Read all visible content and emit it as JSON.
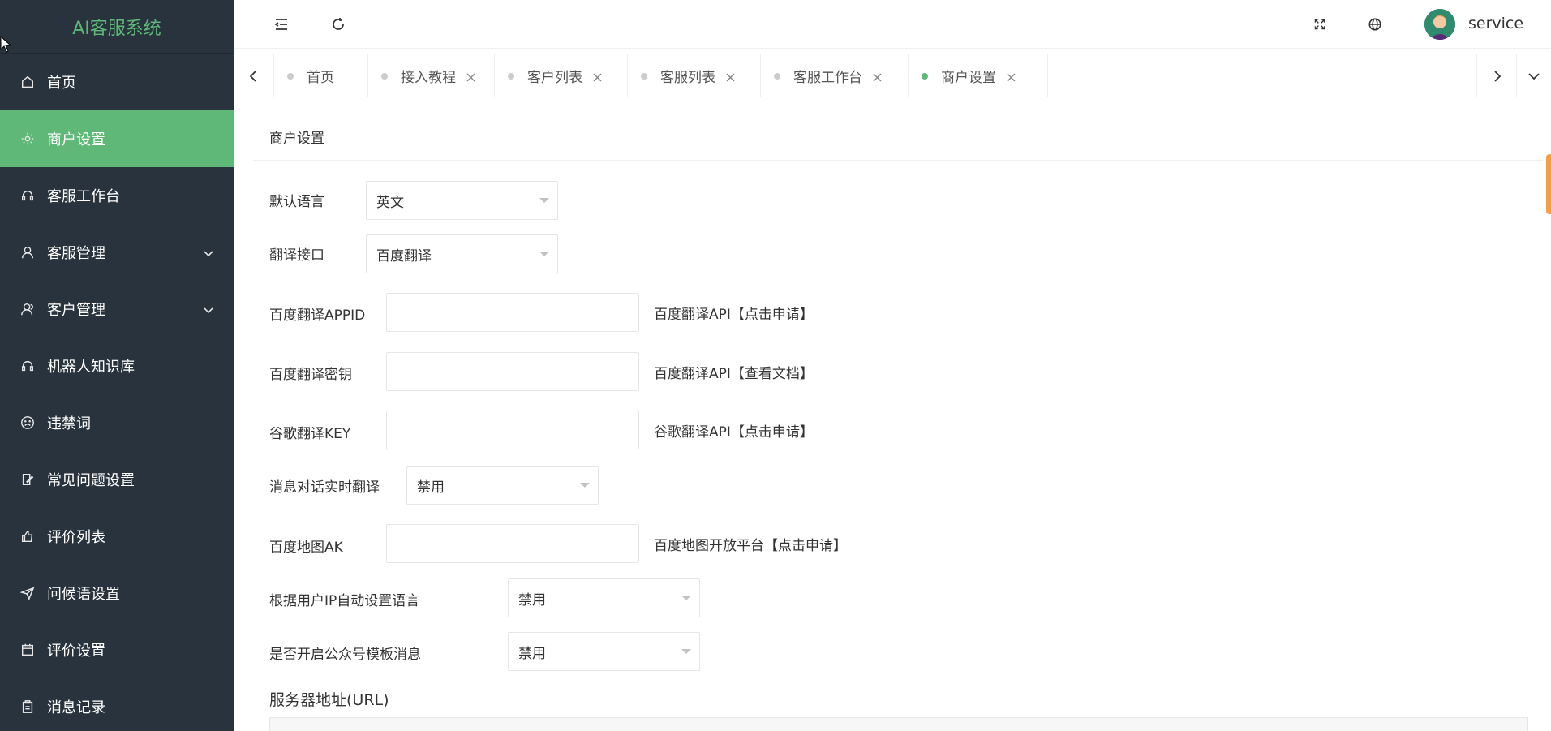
{
  "app": {
    "title": "AI客服系统"
  },
  "sidebar": {
    "items": [
      {
        "label": "首页",
        "icon": "home-icon"
      },
      {
        "label": "商户设置",
        "icon": "gear-icon",
        "active": true
      },
      {
        "label": "客服工作台",
        "icon": "headset-icon"
      },
      {
        "label": "客服管理",
        "icon": "user-icon",
        "expandable": true
      },
      {
        "label": "客户管理",
        "icon": "users-icon",
        "expandable": true
      },
      {
        "label": "机器人知识库",
        "icon": "headset-icon"
      },
      {
        "label": "违禁词",
        "icon": "sad-face-icon"
      },
      {
        "label": "常见问题设置",
        "icon": "edit-icon"
      },
      {
        "label": "评价列表",
        "icon": "thumb-up-icon"
      },
      {
        "label": "问候语设置",
        "icon": "send-icon"
      },
      {
        "label": "评价设置",
        "icon": "calendar-icon"
      },
      {
        "label": "消息记录",
        "icon": "clipboard-icon"
      }
    ]
  },
  "header": {
    "username": "service"
  },
  "tabs": [
    {
      "label": "首页",
      "closable": false,
      "active": false
    },
    {
      "label": "接入教程",
      "closable": true,
      "active": false
    },
    {
      "label": "客户列表",
      "closable": true,
      "active": false
    },
    {
      "label": "客服列表",
      "closable": true,
      "active": false
    },
    {
      "label": "客服工作台",
      "closable": true,
      "active": false
    },
    {
      "label": "商户设置",
      "closable": true,
      "active": true
    }
  ],
  "form": {
    "title": "商户设置",
    "default_language": {
      "label": "默认语言",
      "value": "英文"
    },
    "translate_api": {
      "label": "翻译接口",
      "value": "百度翻译"
    },
    "baidu_appid": {
      "label": "百度翻译APPID",
      "value": "",
      "link": "百度翻译API【点击申请】"
    },
    "baidu_secret": {
      "label": "百度翻译密钥",
      "value": "",
      "link": "百度翻译API【查看文档】"
    },
    "google_key": {
      "label": "谷歌翻译KEY",
      "value": "",
      "link": "谷歌翻译API【点击申请】"
    },
    "realtime_translate": {
      "label": "消息对话实时翻译",
      "value": "禁用"
    },
    "baidu_map_ak": {
      "label": "百度地图AK",
      "value": "",
      "link": "百度地图开放平台【点击申请】"
    },
    "ip_auto_language": {
      "label": "根据用户IP自动设置语言",
      "value": "禁用"
    },
    "wechat_template": {
      "label": "是否开启公众号模板消息",
      "value": "禁用"
    },
    "server_url": {
      "label": "服务器地址(URL)"
    }
  }
}
